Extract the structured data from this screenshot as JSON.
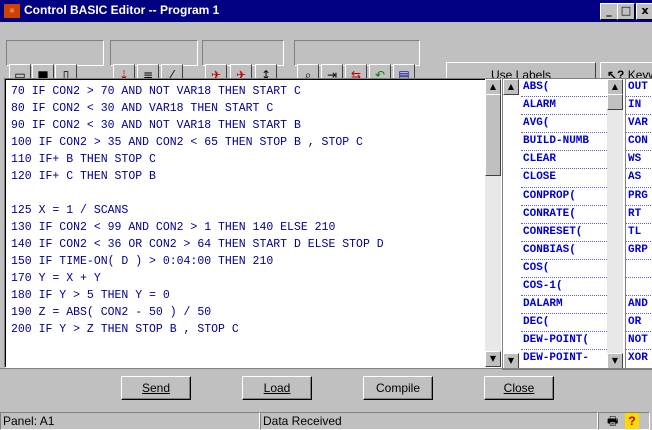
{
  "window": {
    "title": "Control BASIC Editor -- Program 1",
    "app_icon": "app-icon",
    "controls": {
      "minimize": "_",
      "maximize": "□",
      "close": "x"
    }
  },
  "toolbar": {
    "icons": [
      {
        "name": "open-folder-icon",
        "glyph": "📂"
      },
      {
        "name": "save-icon",
        "glyph": "💾"
      },
      {
        "name": "new-document-icon",
        "glyph": "🗋"
      },
      {
        "name": "renumber-icon",
        "glyph": "↓"
      },
      {
        "name": "renumber-step-icon",
        "glyph": "≡"
      },
      {
        "name": "strikethrough-icon",
        "glyph": "⁄"
      },
      {
        "name": "send-icon",
        "glyph": "✈"
      },
      {
        "name": "send-all-icon",
        "glyph": "✈"
      },
      {
        "name": "sort-icon",
        "glyph": "↕"
      },
      {
        "name": "find-icon",
        "glyph": "🔍"
      },
      {
        "name": "goto-icon",
        "glyph": "⇥"
      },
      {
        "name": "replace-icon",
        "glyph": "⇆"
      },
      {
        "name": "undo-icon",
        "glyph": "↶"
      },
      {
        "name": "print-icon",
        "glyph": "▤"
      }
    ],
    "use_labels": "Use Labels",
    "keywords_label": "Keyw",
    "help_icon": "help-cursor-icon"
  },
  "editor": {
    "lines": [
      "70 IF CON2 > 70 AND NOT VAR18 THEN START C",
      "80 IF CON2 < 30 AND VAR18 THEN START C",
      "90 IF CON2 < 30 AND NOT VAR18 THEN START B",
      "100 IF CON2 > 35 AND CON2 < 65 THEN STOP B , STOP C",
      "110 IF+ B THEN STOP C",
      "120 IF+ C THEN STOP B",
      "",
      "125 X = 1 / SCANS",
      "130 IF CON2 < 99 AND CON2 > 1 THEN 140 ELSE 210",
      "140 IF CON2 < 36 OR CON2 > 64 THEN START D ELSE STOP D",
      "150 IF TIME-ON( D ) > 0:04:00 THEN 210",
      "170 Y = X + Y",
      "180 IF Y > 5 THEN Y = 0",
      "190 Z = ABS( CON2 - 50 ) / 50",
      "200 IF Y > Z THEN STOP B , STOP C"
    ]
  },
  "keywords_left": [
    "ABS(",
    "ALARM",
    "AVG(",
    "BUILD-NUMB",
    "CLEAR",
    "CLOSE",
    "CONPROP(",
    "CONRATE(",
    "CONRESET(",
    "CONBIAS(",
    "COS(",
    "COS-1(",
    "DALARM",
    "DEC(",
    "DEW-POINT(",
    "DEW-POINT-"
  ],
  "keywords_right": [
    "OUT",
    "IN",
    "VAR",
    "CON",
    "WS",
    "AS",
    "PRG",
    "RT",
    "TL",
    "GRP",
    "",
    "",
    "AND",
    "OR",
    "NOT",
    "XOR"
  ],
  "buttons": {
    "send": "Send",
    "load": "Load",
    "compile": "Compile",
    "close": "Close"
  },
  "status": {
    "panel": "Panel: A1",
    "message": "Data Received"
  }
}
